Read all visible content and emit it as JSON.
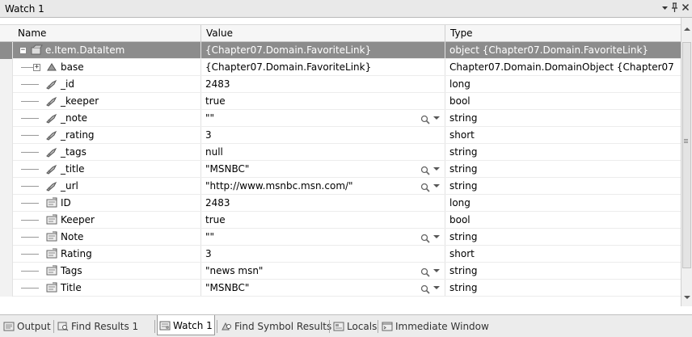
{
  "window": {
    "title": "Watch 1",
    "pin_glyph": "↓ Ɣ",
    "close_glyph": "✕"
  },
  "columns": {
    "name": "Name",
    "value": "Value",
    "type": "Type"
  },
  "rows": [
    {
      "indent": 0,
      "expander": "−",
      "icon": "object-icon",
      "name": "e.Item.DataItem",
      "value": "{Chapter07.Domain.FavoriteLink}",
      "type": "object {Chapter07.Domain.FavoriteLink}",
      "selected": true,
      "magnifier": false
    },
    {
      "indent": 1,
      "expander": "+",
      "icon": "base-class-icon",
      "name": "base",
      "value": "{Chapter07.Domain.FavoriteLink}",
      "type": "Chapter07.Domain.DomainObject {Chapter07",
      "selected": false,
      "magnifier": false
    },
    {
      "indent": 1,
      "expander": "",
      "icon": "field-icon",
      "name": "_id",
      "value": "2483",
      "type": "long",
      "magnifier": false
    },
    {
      "indent": 1,
      "expander": "",
      "icon": "field-icon",
      "name": "_keeper",
      "value": "true",
      "type": "bool",
      "magnifier": false
    },
    {
      "indent": 1,
      "expander": "",
      "icon": "field-icon",
      "name": "_note",
      "value": "\"\"",
      "type": "string",
      "magnifier": true
    },
    {
      "indent": 1,
      "expander": "",
      "icon": "field-icon",
      "name": "_rating",
      "value": "3",
      "type": "short",
      "magnifier": false
    },
    {
      "indent": 1,
      "expander": "",
      "icon": "field-icon",
      "name": "_tags",
      "value": "null",
      "type": "string",
      "magnifier": false
    },
    {
      "indent": 1,
      "expander": "",
      "icon": "field-icon",
      "name": "_title",
      "value": "\"MSNBC\"",
      "type": "string",
      "magnifier": true
    },
    {
      "indent": 1,
      "expander": "",
      "icon": "field-icon",
      "name": "_url",
      "value": "\"http://www.msnbc.msn.com/\"",
      "type": "string",
      "magnifier": true
    },
    {
      "indent": 1,
      "expander": "",
      "icon": "property-icon",
      "name": "ID",
      "value": "2483",
      "type": "long",
      "magnifier": false
    },
    {
      "indent": 1,
      "expander": "",
      "icon": "property-icon",
      "name": "Keeper",
      "value": "true",
      "type": "bool",
      "magnifier": false
    },
    {
      "indent": 1,
      "expander": "",
      "icon": "property-icon",
      "name": "Note",
      "value": "\"\"",
      "type": "string",
      "magnifier": true
    },
    {
      "indent": 1,
      "expander": "",
      "icon": "property-icon",
      "name": "Rating",
      "value": "3",
      "type": "short",
      "magnifier": false
    },
    {
      "indent": 1,
      "expander": "",
      "icon": "property-icon",
      "name": "Tags",
      "value": "\"news msn\"",
      "type": "string",
      "magnifier": true
    },
    {
      "indent": 1,
      "expander": "",
      "icon": "property-icon",
      "name": "Title",
      "value": "\"MSNBC\"",
      "type": "string",
      "magnifier": true
    }
  ],
  "tabs": [
    {
      "label": "Output",
      "icon": "output-icon",
      "active": false
    },
    {
      "label": "Find Results 1",
      "icon": "find-results-icon",
      "active": false
    },
    {
      "label": "Watch 1",
      "icon": "watch-icon",
      "active": true
    },
    {
      "label": "Find Symbol Results",
      "icon": "find-symbol-icon",
      "active": false
    },
    {
      "label": "Locals",
      "icon": "locals-icon",
      "active": false
    },
    {
      "label": "Immediate Window",
      "icon": "immediate-window-icon",
      "active": false
    }
  ],
  "colors": {
    "selected_row": "#8c8c8c",
    "header_bg": "#f6f6f6",
    "tab_bar": "#ececec"
  }
}
